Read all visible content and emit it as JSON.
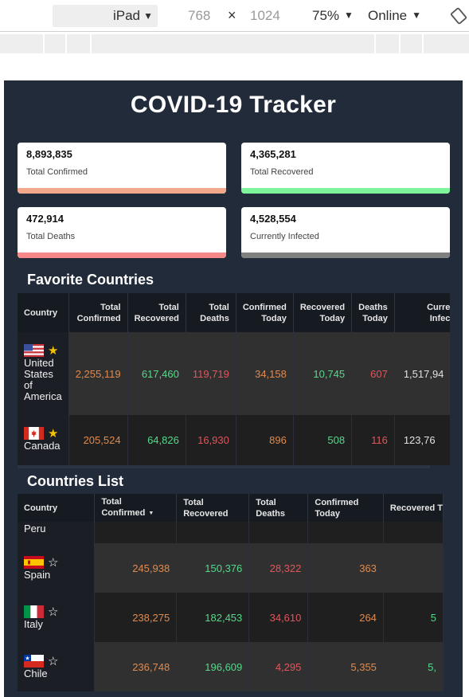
{
  "devtools": {
    "device": "iPad",
    "width": "768",
    "times": "×",
    "height": "1024",
    "zoom": "75%",
    "network": "Online"
  },
  "app": {
    "title": "COVID-19 Tracker"
  },
  "stats": [
    {
      "value": "8,893,835",
      "label": "Total Confirmed",
      "color": "#f2a98b"
    },
    {
      "value": "4,365,281",
      "label": "Total Recovered",
      "color": "#7ef59b"
    },
    {
      "value": "472,914",
      "label": "Total Deaths",
      "color": "#f7888a"
    },
    {
      "value": "4,528,554",
      "label": "Currently Infected",
      "color": "#808080"
    }
  ],
  "favorites": {
    "title": "Favorite Countries",
    "headers": {
      "country": "Country",
      "total_confirmed_1": "Total",
      "total_confirmed_2": "Confirmed",
      "total_recovered_1": "Total",
      "total_recovered_2": "Recovered",
      "total_deaths_1": "Total",
      "total_deaths_2": "Deaths",
      "confirmed_today_1": "Confirmed",
      "confirmed_today_2": "Today",
      "recovered_today_1": "Recovered",
      "recovered_today_2": "Today",
      "deaths_today_1": "Deaths",
      "deaths_today_2": "Today",
      "currently_infected_1": "Curre",
      "currently_infected_2": "Infec"
    },
    "rows": [
      {
        "country_1": "United",
        "country_2": "States",
        "country_3": "of",
        "country_4": "America",
        "total_confirmed": "2,255,119",
        "total_recovered": "617,460",
        "total_deaths": "119,719",
        "confirmed_today": "34,158",
        "recovered_today": "10,745",
        "deaths_today": "607",
        "currently_infected": "1,517,94"
      },
      {
        "country_1": "Canada",
        "total_confirmed": "205,524",
        "total_recovered": "64,826",
        "total_deaths": "16,930",
        "confirmed_today": "896",
        "recovered_today": "508",
        "deaths_today": "116",
        "currently_infected": "123,76"
      }
    ]
  },
  "countries": {
    "title": "Countries List",
    "headers": {
      "country": "Country",
      "total_confirmed": "Total Confirmed",
      "total_recovered": "Total Recovered",
      "total_deaths": "Total Deaths",
      "confirmed_today": "Confirmed Today",
      "recovered_today": "Recovered T"
    },
    "partial_row": "Peru",
    "rows": [
      {
        "country": "Spain",
        "total_confirmed": "245,938",
        "total_recovered": "150,376",
        "total_deaths": "28,322",
        "confirmed_today": "363",
        "recovered_today": ""
      },
      {
        "country": "Italy",
        "total_confirmed": "238,275",
        "total_recovered": "182,453",
        "total_deaths": "34,610",
        "confirmed_today": "264",
        "recovered_today": "5"
      },
      {
        "country": "Chile",
        "total_confirmed": "236,748",
        "total_recovered": "196,609",
        "total_deaths": "4,295",
        "confirmed_today": "5,355",
        "recovered_today": "5,"
      }
    ]
  }
}
